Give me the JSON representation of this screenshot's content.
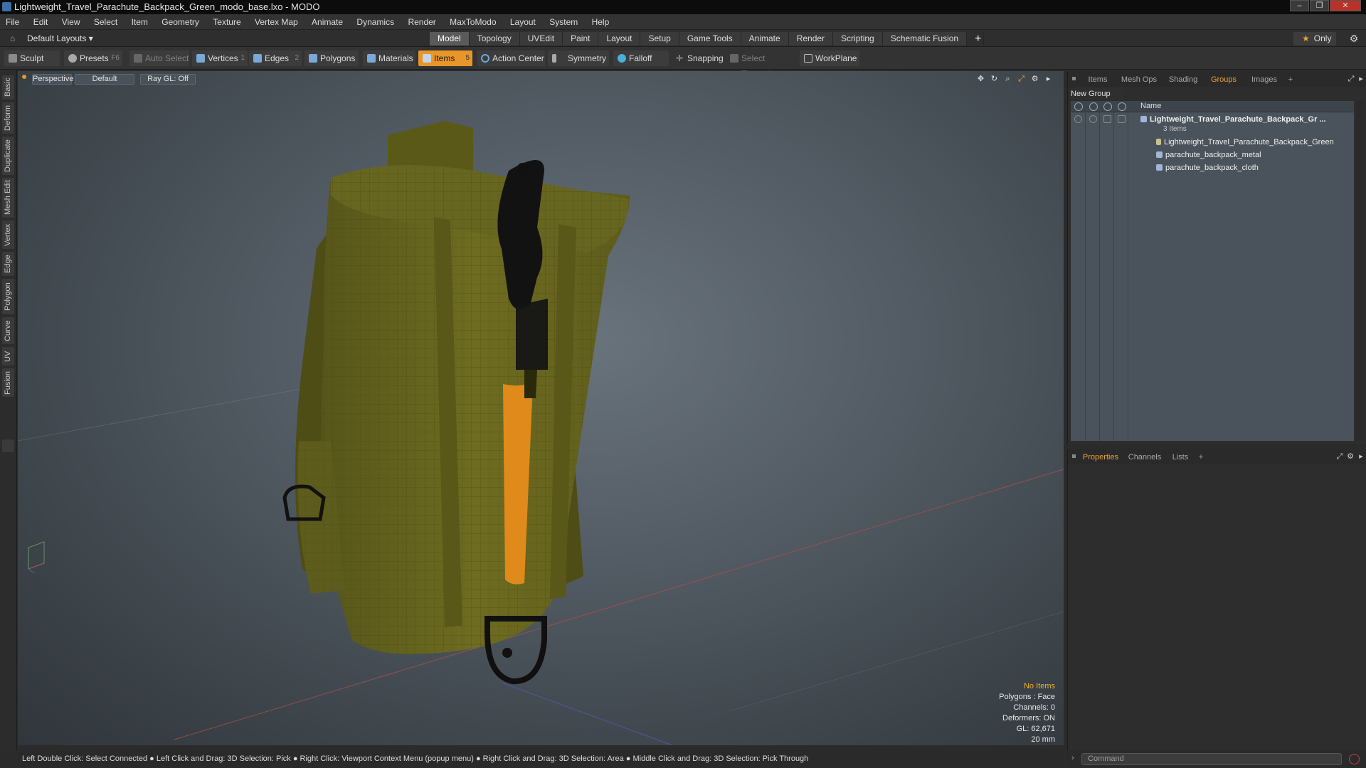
{
  "window": {
    "title": "Lightweight_Travel_Parachute_Backpack_Green_modo_base.lxo - MODO",
    "min": "–",
    "max": "❐",
    "close": "✕"
  },
  "menu": [
    "File",
    "Edit",
    "View",
    "Select",
    "Item",
    "Geometry",
    "Texture",
    "Vertex Map",
    "Animate",
    "Dynamics",
    "Render",
    "MaxToModo",
    "Layout",
    "System",
    "Help"
  ],
  "layout_selector": "Default Layouts ▾",
  "mode_tabs": [
    "Model",
    "Topology",
    "UVEdit",
    "Paint",
    "Layout",
    "Setup",
    "Game Tools",
    "Animate",
    "Render",
    "Scripting",
    "Schematic Fusion"
  ],
  "mode_plus": "+",
  "only_button": {
    "star": "★",
    "label": "Only"
  },
  "toolbar": {
    "sculpt": "Sculpt",
    "presets": "Presets",
    "presets_key": "F6",
    "auto_select": "Auto Select",
    "vertices": "Vertices",
    "vertices_key": "1",
    "edges": "Edges",
    "edges_key": "2",
    "polygons": "Polygons",
    "materials": "Materials",
    "items": "Items",
    "items_key": "5",
    "action_center": "Action Center",
    "symmetry": "Symmetry",
    "falloff": "Falloff",
    "snapping": "Snapping",
    "select_through": "Select Through",
    "workplane": "WorkPlane"
  },
  "left_tabs": [
    "Basic",
    "Deform",
    "Duplicate",
    "Mesh Edit",
    "Vertex",
    "Edge",
    "Polygon",
    "Curve",
    "UV",
    "Fusion"
  ],
  "viewport": {
    "view": "Perspective",
    "shading": "Default",
    "raygl": "Ray GL: Off",
    "stats": {
      "header": "No Items",
      "polygons": "Polygons : Face",
      "channels": "Channels: 0",
      "deformers": "Deformers: ON",
      "gl": "GL: 62,671",
      "scale": "20 mm"
    }
  },
  "status_bar": "Left Double Click: Select Connected ● Left Click and Drag: 3D Selection: Pick ● Right Click: Viewport Context Menu (popup menu) ● Right Click and Drag: 3D Selection: Area ● Middle Click and Drag: 3D Selection: Pick Through",
  "right_panel": {
    "tabs": [
      "Items",
      "Mesh Ops",
      "Shading",
      "Groups",
      "Images"
    ],
    "active_tab": "Groups",
    "tab_plus": "+",
    "new_group": "New Group",
    "column_name": "Name",
    "group": {
      "name": "Lightweight_Travel_Parachute_Backpack_Gr ...",
      "count": "3 Items"
    },
    "children": [
      "Lightweight_Travel_Parachute_Backpack_Green",
      "parachute_backpack_metal",
      "parachute_backpack_cloth"
    ]
  },
  "properties_panel": {
    "tabs": [
      "Properties",
      "Channels",
      "Lists"
    ],
    "active_tab": "Properties",
    "tab_plus": "+"
  },
  "command": {
    "placeholder": "Command"
  },
  "colors": {
    "accent": "#e8962a",
    "active_tab_text": "#f0a030",
    "backpack": "#6b6a1e",
    "strap": "#e08a1c"
  }
}
